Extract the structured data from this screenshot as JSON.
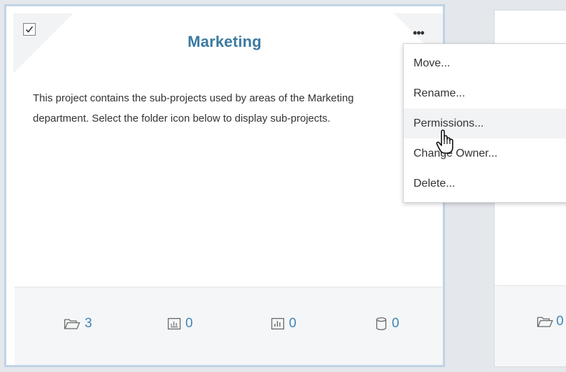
{
  "project_card": {
    "title": "Marketing",
    "selected": true,
    "more_label": "•••",
    "description": "This project contains the sub-projects used by areas of the Marketing department. Select the folder icon below to display sub-projects.",
    "stats": [
      {
        "icon": "folder-icon",
        "count": "3"
      },
      {
        "icon": "workbook-icon",
        "count": "0"
      },
      {
        "icon": "view-icon",
        "count": "0"
      },
      {
        "icon": "datasource-icon",
        "count": "0"
      }
    ]
  },
  "second_card": {
    "stat_icon": "folder-icon",
    "stat_count": "0"
  },
  "context_menu": {
    "items": [
      {
        "label": "Move..."
      },
      {
        "label": "Rename..."
      },
      {
        "label": "Permissions...",
        "hovered": true
      },
      {
        "label": "Change Owner..."
      },
      {
        "label": "Delete..."
      }
    ]
  },
  "colors": {
    "title": "#3b7aa0",
    "stat": "#3d84b8",
    "selected_border": "#bfd3e6"
  }
}
